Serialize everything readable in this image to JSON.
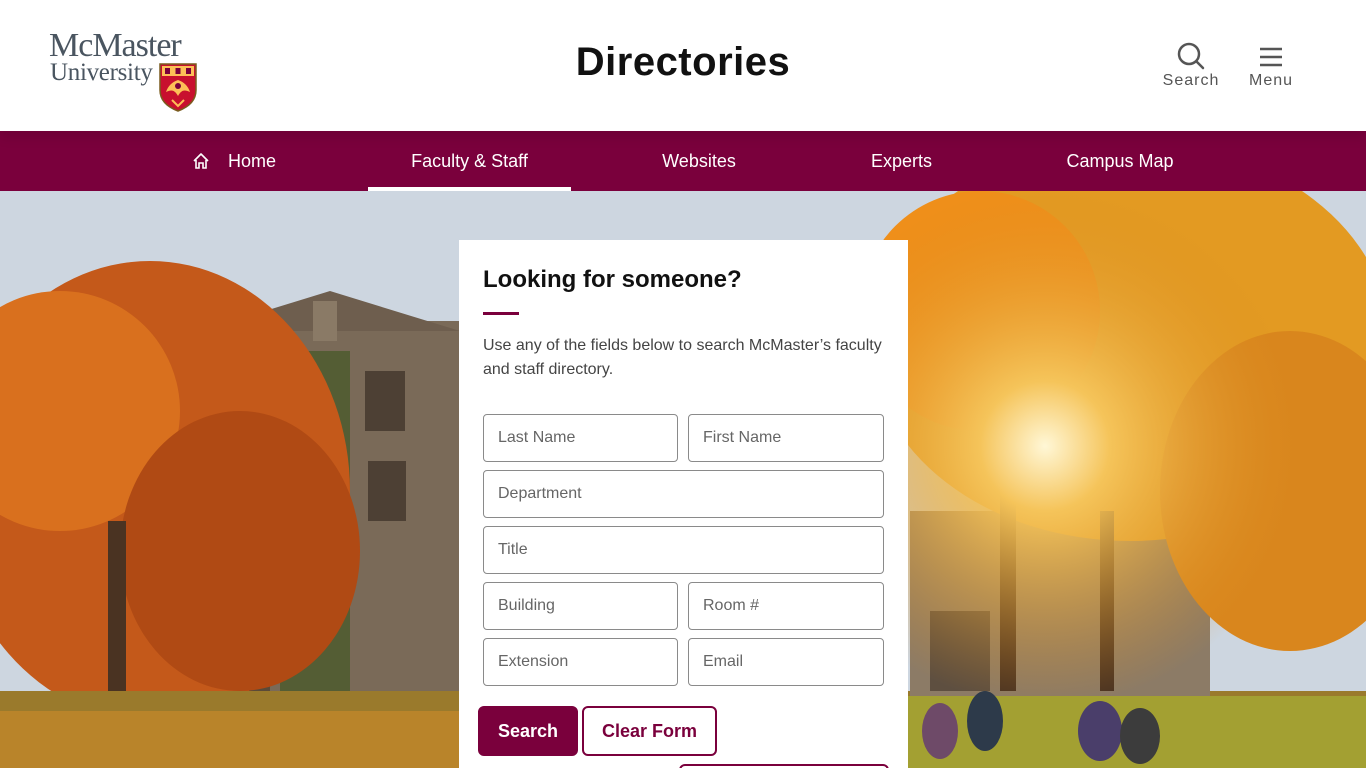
{
  "header": {
    "logo": {
      "name": "McMaster",
      "university": "University"
    },
    "title": "Directories",
    "search_label": "Search",
    "menu_label": "Menu"
  },
  "nav": {
    "items": [
      {
        "label": "Home",
        "icon": "home-icon",
        "active": false
      },
      {
        "label": "Faculty & Staff",
        "active": true
      },
      {
        "label": "Websites",
        "active": false
      },
      {
        "label": "Experts",
        "active": false
      },
      {
        "label": "Campus Map",
        "active": false
      }
    ]
  },
  "card": {
    "title": "Looking for someone?",
    "description": "Use any of the fields below to search McMaster’s faculty and staff directory.",
    "fields": {
      "last_name": "Last Name",
      "first_name": "First Name",
      "department": "Department",
      "title": "Title",
      "building": "Building",
      "room": "Room #",
      "extension": "Extension",
      "email": "Email"
    },
    "search_button": "Search",
    "clear_button": "Clear Form"
  },
  "colors": {
    "brand_maroon": "#7a003c",
    "crest_gold": "#fdbf57"
  }
}
